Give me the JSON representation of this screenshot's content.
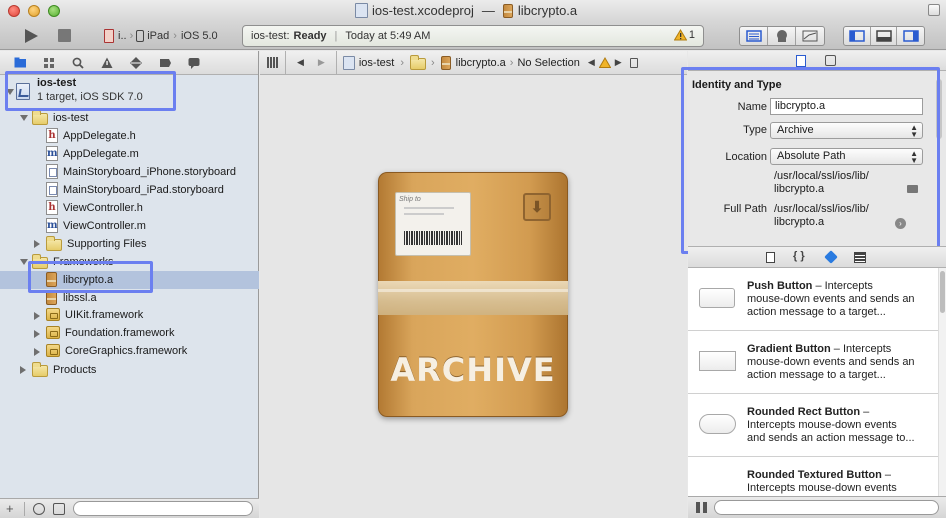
{
  "window": {
    "title_project": "ios-test.xcodeproj",
    "title_separator": "—",
    "title_file": "libcrypto.a"
  },
  "toolbar": {
    "scheme_app": "i..",
    "scheme_device": "iPad",
    "scheme_sdk": "iOS 5.0",
    "activity_project": "ios-test:",
    "activity_status": "Ready",
    "activity_separator": "|",
    "activity_time": "Today at 5:49 AM",
    "warning_count": "1"
  },
  "navigator": {
    "project": {
      "name": "ios-test",
      "subtitle": "1 target, iOS SDK 7.0"
    },
    "items": [
      {
        "label": "ios-test",
        "kind": "folder",
        "level": 1,
        "disclosure": "open"
      },
      {
        "label": "AppDelegate.h",
        "kind": "h",
        "level": 2
      },
      {
        "label": "AppDelegate.m",
        "kind": "m",
        "level": 2
      },
      {
        "label": "MainStoryboard_iPhone.storyboard",
        "kind": "storyboard",
        "level": 2
      },
      {
        "label": "MainStoryboard_iPad.storyboard",
        "kind": "storyboard",
        "level": 2
      },
      {
        "label": "ViewController.h",
        "kind": "h",
        "level": 2
      },
      {
        "label": "ViewController.m",
        "kind": "m",
        "level": 2
      },
      {
        "label": "Supporting Files",
        "kind": "folder",
        "level": 2,
        "disclosure": "closed"
      },
      {
        "label": "Frameworks",
        "kind": "folder",
        "level": 1,
        "disclosure": "open"
      },
      {
        "label": "libcrypto.a",
        "kind": "lib",
        "level": 2,
        "selected": true
      },
      {
        "label": "libssl.a",
        "kind": "lib",
        "level": 2
      },
      {
        "label": "UIKit.framework",
        "kind": "framework",
        "level": 2,
        "disclosure": "closed"
      },
      {
        "label": "Foundation.framework",
        "kind": "framework",
        "level": 2,
        "disclosure": "closed"
      },
      {
        "label": "CoreGraphics.framework",
        "kind": "framework",
        "level": 2,
        "disclosure": "closed"
      },
      {
        "label": "Products",
        "kind": "folder",
        "level": 1,
        "disclosure": "closed"
      }
    ]
  },
  "jumpbar": {
    "project": "ios-test",
    "file": "libcrypto.a",
    "selection": "No Selection"
  },
  "editor": {
    "shipping_label": "Ship to",
    "archive_label": "ARCHIVE"
  },
  "inspector": {
    "section_title": "Identity and Type",
    "name_label": "Name",
    "name_value": "libcrypto.a",
    "type_label": "Type",
    "type_value": "Archive",
    "location_label": "Location",
    "location_value": "Absolute Path",
    "location_path_line1": "/usr/local/ssl/ios/lib/",
    "location_path_line2": "libcrypto.a",
    "fullpath_label": "Full Path",
    "fullpath_line1": "/usr/local/ssl/ios/lib/",
    "fullpath_line2": "libcrypto.a"
  },
  "library": {
    "items": [
      {
        "title": "Push Button",
        "desc1": " – Intercepts",
        "desc2": "mouse-down events and sends an",
        "desc3": "action message to a target..."
      },
      {
        "title": "Gradient Button",
        "desc1": " – Intercepts",
        "desc2": "mouse-down events and sends an",
        "desc3": "action message to a target..."
      },
      {
        "title": "Rounded Rect Button",
        "desc1": " –",
        "desc2": "Intercepts mouse-down events",
        "desc3": "and sends an action message to..."
      },
      {
        "title": "Rounded Textured Button",
        "desc1": " –",
        "desc2": "Intercepts mouse-down events",
        "desc3": ""
      }
    ]
  },
  "colors": {
    "highlight": "#6b7ff0",
    "selection": "#b3c3dd",
    "navigator_bg": "#dde4ec"
  }
}
